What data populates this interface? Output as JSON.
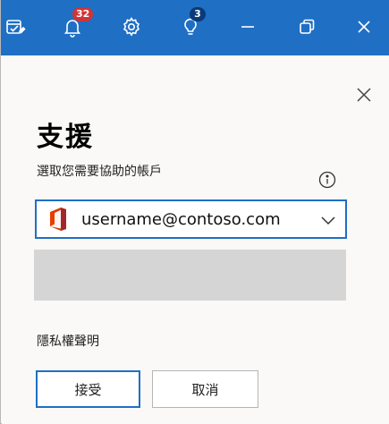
{
  "titlebar": {
    "icons": [
      "tasks-icon",
      "bell-icon",
      "gear-icon",
      "lightbulb-icon",
      "minimize-icon",
      "restore-icon",
      "close-icon"
    ],
    "notifications_count": "32",
    "tips_count": "3",
    "accent_color": "#1f6fc4"
  },
  "dialog": {
    "title": "支援",
    "prompt": "選取您需要協助的帳戶",
    "account": "username@contoso.com",
    "privacy_link": "隱私權聲明",
    "accept_label": "接受",
    "cancel_label": "取消"
  }
}
